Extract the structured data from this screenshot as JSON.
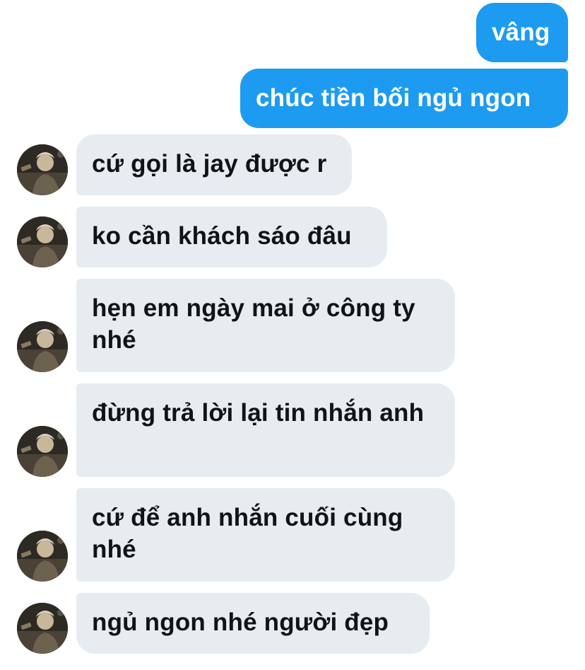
{
  "conversation": {
    "outgoing": [
      {
        "text": "vâng"
      },
      {
        "text": "chúc tiền bối ngủ ngon"
      }
    ],
    "incoming": [
      {
        "text": "cứ gọi là jay được r"
      },
      {
        "text": "ko cần khách sáo đâu"
      },
      {
        "text": "hẹn em ngày mai ở công ty nhé"
      },
      {
        "text": "đừng trả lời lại tin nhắn anh"
      },
      {
        "text": "cứ để anh nhắn cuối cùng nhé"
      },
      {
        "text": "ngủ ngon nhé người đẹp"
      }
    ]
  },
  "colors": {
    "outgoing_bubble": "#1d9bf0",
    "incoming_bubble": "#e7ecf0",
    "incoming_text": "#0f1419",
    "outgoing_text": "#ffffff"
  },
  "icons": {
    "sender_avatar": "profile-photo"
  }
}
